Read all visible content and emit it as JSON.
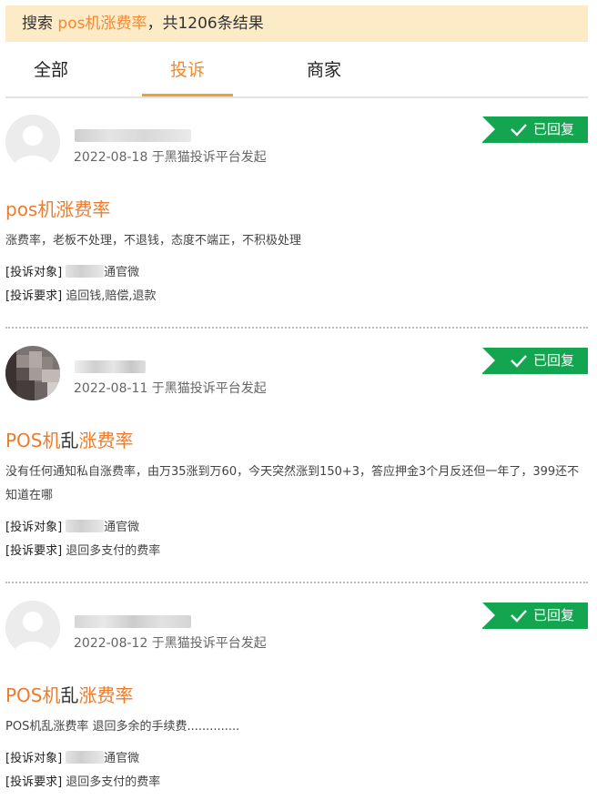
{
  "search": {
    "prefix": "搜索 ",
    "keyword": "pos机涨费率",
    "suffix": "，共1206条结果"
  },
  "tabs": [
    {
      "label": "全部",
      "active": false
    },
    {
      "label": "投诉",
      "active": true
    },
    {
      "label": "商家",
      "active": false
    }
  ],
  "colors": {
    "accent": "#f08a33",
    "badge": "#13a550",
    "banner": "#fdebc8"
  },
  "complaints": [
    {
      "date": "2022-08-18 于黑猫投诉平台发起",
      "badge": "已回复",
      "title_parts": [
        {
          "text": "pos机涨费率",
          "highlight": true
        }
      ],
      "description": "涨费率，老板不处理，不退钱，态度不端正，不积极处理",
      "target_label": "[投诉对象]",
      "target_value": "通官微",
      "request_label": "[投诉要求]",
      "request_value": "追回钱,赔偿,退款"
    },
    {
      "date": "2022-08-11 于黑猫投诉平台发起",
      "badge": "已回复",
      "title_parts": [
        {
          "text": "POS机",
          "highlight": true
        },
        {
          "text": "乱",
          "highlight": false
        },
        {
          "text": "涨费率",
          "highlight": true
        }
      ],
      "description": "没有任何通知私自涨费率，由万35涨到万60，今天突然涨到150+3，答应押金3个月反还但一年了，399还不知道在哪",
      "target_label": "[投诉对象]",
      "target_value": "通官微",
      "request_label": "[投诉要求]",
      "request_value": "退回多支付的费率"
    },
    {
      "date": "2022-08-12 于黑猫投诉平台发起",
      "badge": "已回复",
      "title_parts": [
        {
          "text": "POS机",
          "highlight": true
        },
        {
          "text": "乱",
          "highlight": false
        },
        {
          "text": "涨费率",
          "highlight": true
        }
      ],
      "description": "POS机乱涨费率 退回多余的手续费..............",
      "target_label": "[投诉对象]",
      "target_value": "通官微",
      "request_label": "[投诉要求]",
      "request_value": "退回多支付的费率"
    }
  ]
}
